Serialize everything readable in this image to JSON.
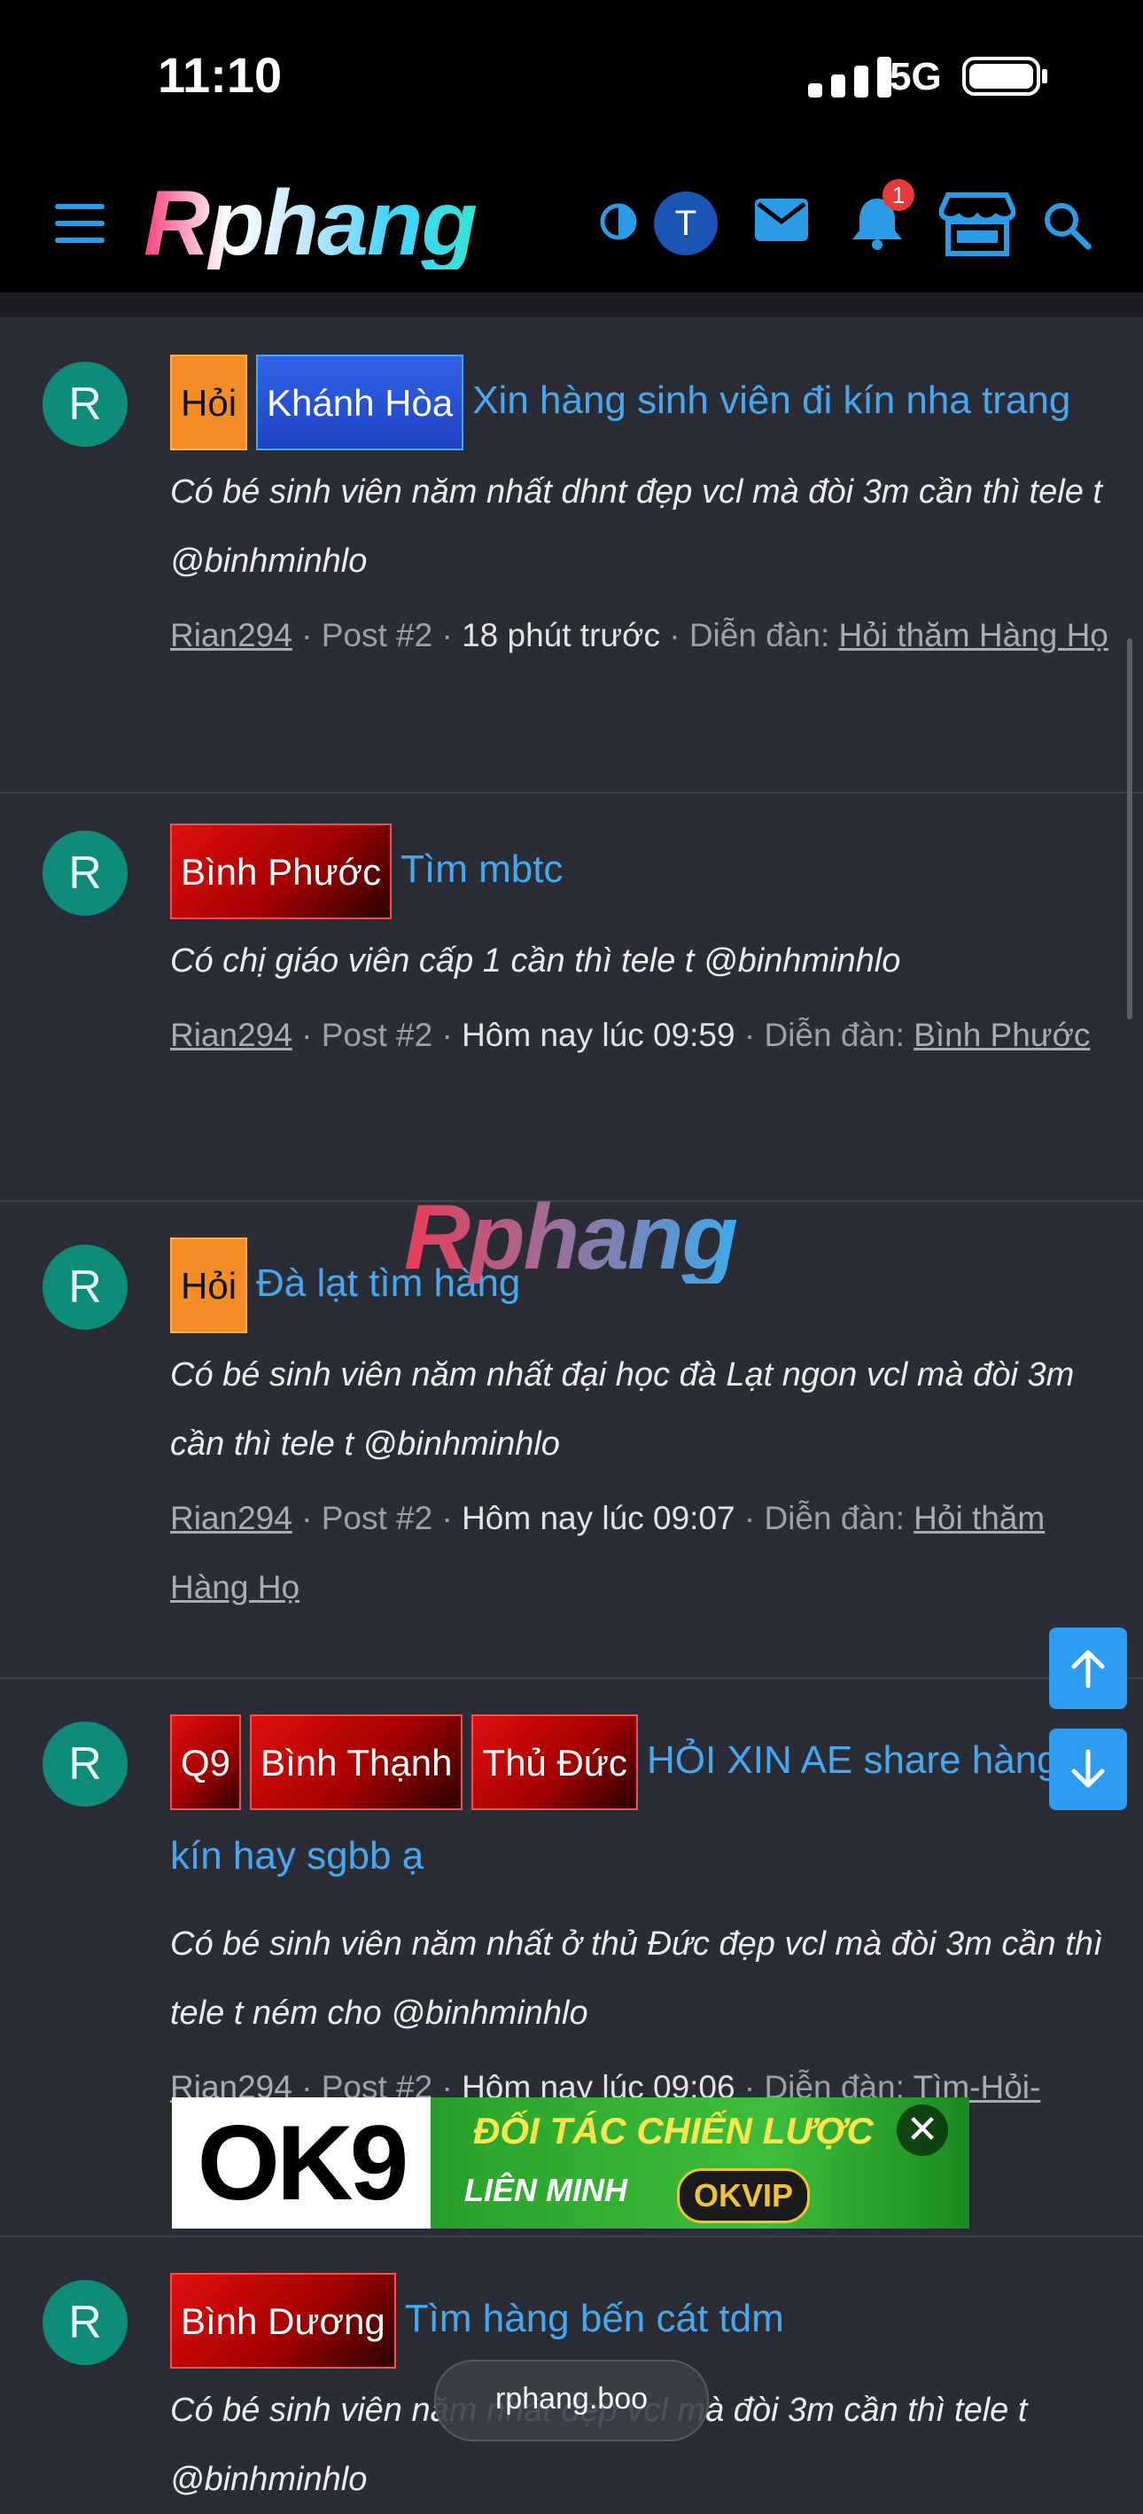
{
  "status_bar": {
    "time": "11:10",
    "network": "5G"
  },
  "nav": {
    "logo_text": "Rphang",
    "avatar_initial": "T",
    "notification_count": "1",
    "icons": [
      "menu-icon",
      "theme-toggle-icon",
      "mail-icon",
      "bell-icon",
      "store-icon",
      "search-icon"
    ]
  },
  "threads": [
    {
      "avatar": "R",
      "tags": [
        {
          "label": "Hỏi",
          "style": "hoi"
        },
        {
          "label": "Khánh Hòa",
          "style": "blue"
        }
      ],
      "title": "Xin hàng sinh viên đi kín nha trang",
      "snippet": "Có bé sinh viên năm nhất dhnt đẹp vcl mà đòi 3m cần thì tele t @binhminhlo",
      "author": "Rian294",
      "post": " · Post #2 · ",
      "when": "18 phút trước",
      "forum_prefix": " · Diễn đàn: ",
      "forum": "Hỏi thăm Hàng Họ"
    },
    {
      "avatar": "R",
      "tags": [
        {
          "label": "Bình Phước",
          "style": "red"
        }
      ],
      "title": "Tìm mbtc",
      "snippet": "Có chị giáo viên cấp 1 cần thì tele t @binhminhlo",
      "author": "Rian294",
      "post": " · Post #2 · ",
      "when": "Hôm nay lúc 09:59",
      "forum_prefix": " · Diễn đàn: ",
      "forum": "Bình Phước"
    },
    {
      "avatar": "R",
      "tags": [
        {
          "label": "Hỏi",
          "style": "hoi"
        }
      ],
      "title": "Đà lạt tìm hàng",
      "snippet": "Có bé sinh viên năm nhất đại học đà Lạt ngon vcl mà đòi 3m cần thì tele t @binhminhlo",
      "author": "Rian294",
      "post": " · Post #2 · ",
      "when": "Hôm nay lúc 09:07",
      "forum_prefix": " · Diễn đàn: ",
      "forum": "Hỏi thăm Hàng Họ"
    },
    {
      "avatar": "R",
      "tags": [
        {
          "label": "Q9",
          "style": "red"
        },
        {
          "label": "Bình Thạnh",
          "style": "red"
        },
        {
          "label": "Thủ Đức",
          "style": "red"
        }
      ],
      "title": "HỎI XIN AE share hàng đi kín hay sgbb ạ",
      "snippet": "Có bé sinh viên năm nhất ở thủ Đức đẹp vcl mà đòi 3m cần thì tele t ném cho @binhminhlo",
      "author": "Rian294",
      "post": " · Post #2 · ",
      "when": "Hôm nay lúc 09:06",
      "forum_prefix": " · Diễn đàn: ",
      "forum": "Tìm-Hỏi-"
    },
    {
      "avatar": "R",
      "tags": [
        {
          "label": "Bình Dương",
          "style": "red"
        }
      ],
      "title": "Tìm hàng bến cát tdm",
      "snippet": "Có bé sinh viên năm nhất đẹp vcl mà đòi 3m cần thì tele t @binhminhlo"
    }
  ],
  "watermark": "Rphang",
  "ad": {
    "brand": "OK9",
    "line1": "ĐỐI TÁC CHIẾN LƯỢC",
    "line2": "LIÊN MINH",
    "partner": "OKVIP",
    "close": "✕"
  },
  "url": "rphang.boo"
}
